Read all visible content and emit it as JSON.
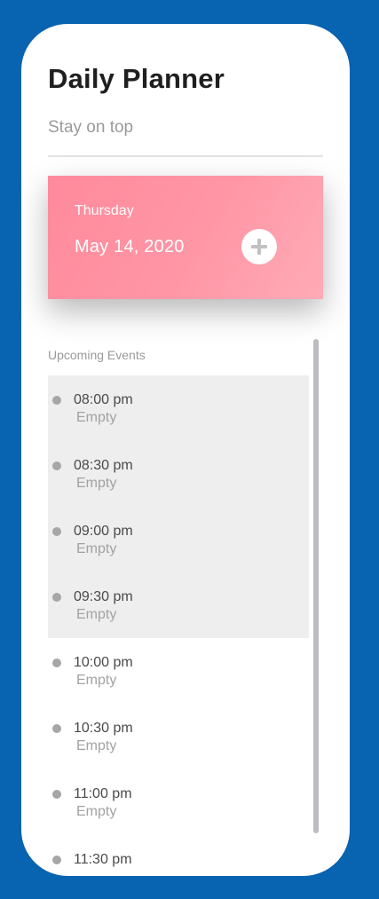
{
  "header": {
    "title": "Daily Planner",
    "subtitle": "Stay on top"
  },
  "date_card": {
    "day": "Thursday",
    "date": "May 14, 2020",
    "add_icon": "plus-icon"
  },
  "events": {
    "section_label": "Upcoming Events",
    "items": [
      {
        "time": "08:00 pm",
        "status": "Empty",
        "highlighted": true
      },
      {
        "time": "08:30 pm",
        "status": "Empty",
        "highlighted": true
      },
      {
        "time": "09:00 pm",
        "status": "Empty",
        "highlighted": true
      },
      {
        "time": "09:30 pm",
        "status": "Empty",
        "highlighted": true
      },
      {
        "time": "10:00 pm",
        "status": "Empty",
        "highlighted": false
      },
      {
        "time": "10:30 pm",
        "status": "Empty",
        "highlighted": false
      },
      {
        "time": "11:00 pm",
        "status": "Empty",
        "highlighted": false
      },
      {
        "time": "11:30 pm",
        "status": "",
        "highlighted": false
      }
    ]
  },
  "colors": {
    "background": "#0863b0",
    "card_gradient_start": "#ff8a9b",
    "card_gradient_end": "#ffabb6",
    "highlight_row": "#eeeeee"
  }
}
